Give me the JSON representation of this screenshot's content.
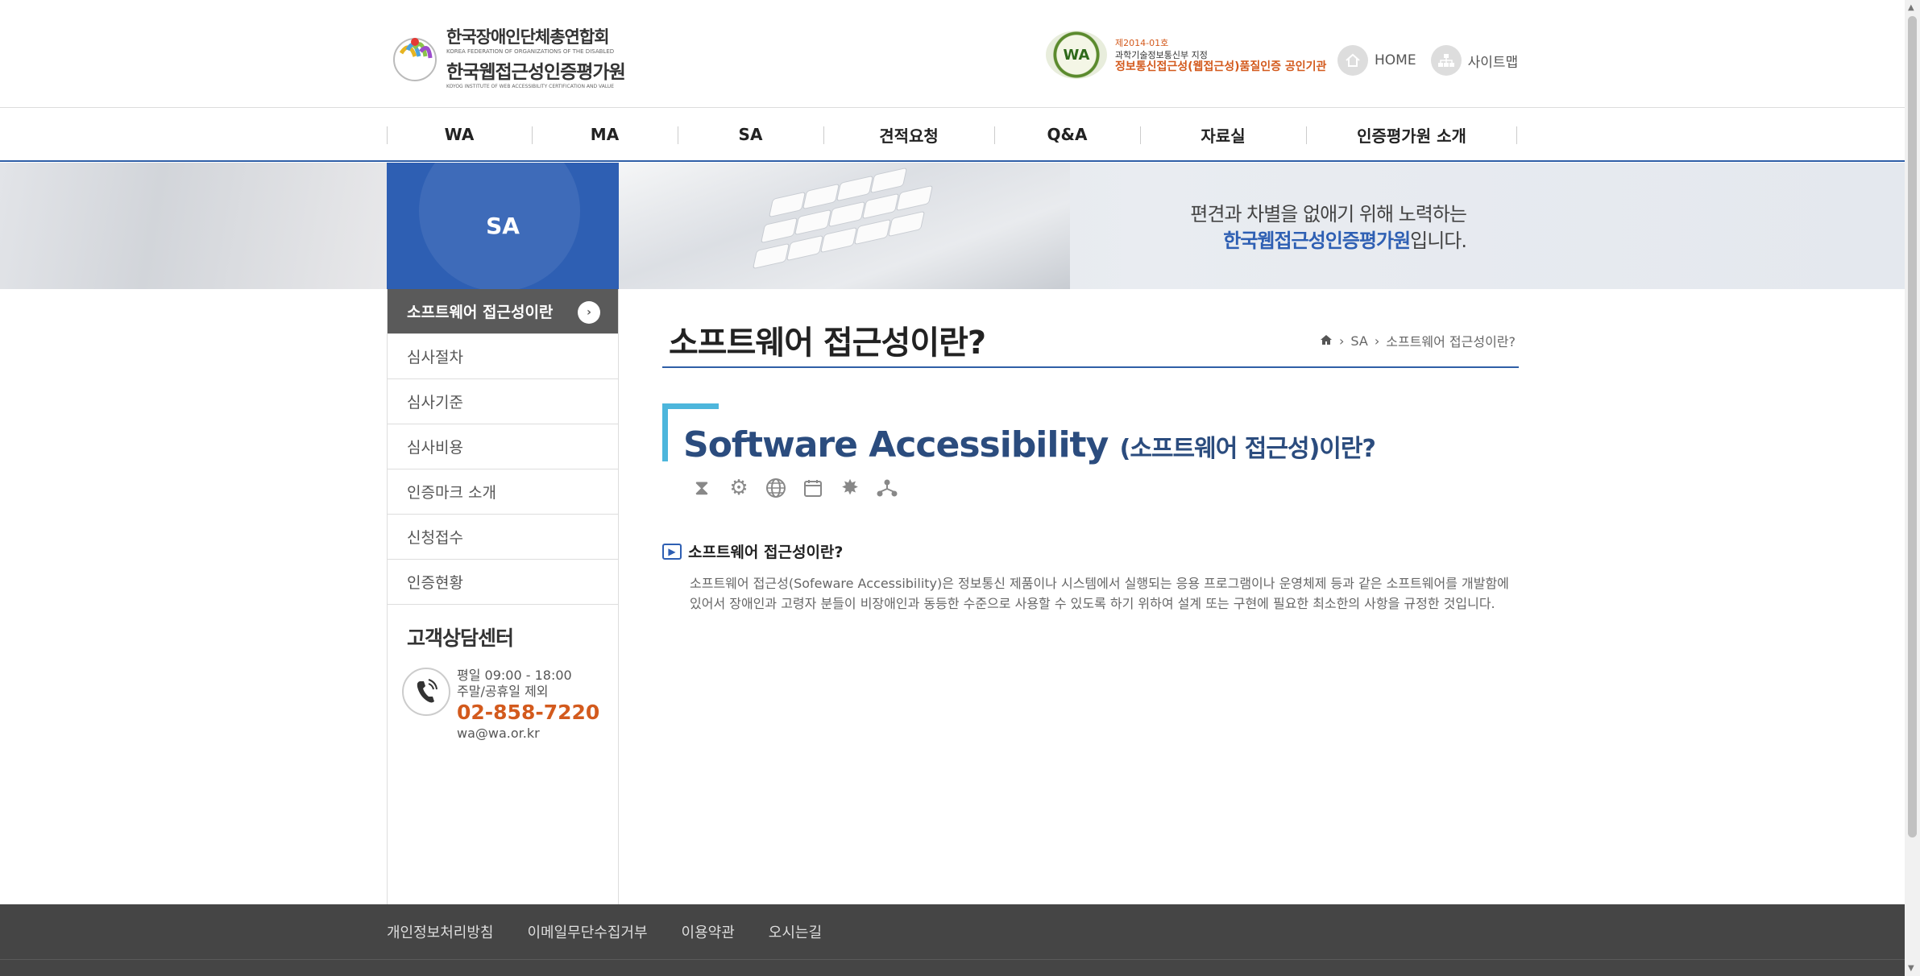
{
  "header": {
    "logo": {
      "line1": "한국장애인단체총연합회",
      "line1_en": "KOREA FEDERATION OF ORGANIZATIONS OF THE DISABLED",
      "line2": "한국웹접근성인증평가원",
      "line2_en": "KOYOG INSTITUTE OF WEB ACCESSIBILITY CERTIFICATION AND VALUE"
    },
    "cert": {
      "badge": "WA",
      "no": "제2014-01호",
      "line2": "과학기술정보통신부 지정",
      "line3": "정보통신접근성(웹접근성)품질인증 공인기관"
    },
    "links": {
      "home": "HOME",
      "sitemap": "사이트맵"
    }
  },
  "nav": {
    "items": [
      "WA",
      "MA",
      "SA",
      "견적요청",
      "Q&A",
      "자료실",
      "인증평가원 소개"
    ]
  },
  "banner": {
    "section": "SA",
    "line1": "편견과 차별을 없애기 위해 노력하는",
    "line2_highlight": "한국웹접근성인증평가원",
    "line2_rest": "입니다."
  },
  "sidebar": {
    "items": [
      "소프트웨어 접근성이란",
      "심사절차",
      "심사기준",
      "심사비용",
      "인증마크 소개",
      "신청접수",
      "인증현황"
    ],
    "active_arrow": "›",
    "cs_title": "고객상담센터",
    "cs_hours1": "평일 09:00 - 18:00",
    "cs_hours2": "주말/공휴일 제외",
    "cs_phone": "02-858-7220",
    "cs_email": "wa@wa.or.kr"
  },
  "content": {
    "title": "소프트웨어 접근성이란?",
    "breadcrumb": [
      "SA",
      "소프트웨어 접근성이란?"
    ],
    "sa_title": "Software Accessibility",
    "sa_sub": "(소프트웨어 접근성)이란?",
    "section_title": "소프트웨어 접근성이란?",
    "section_line1": "소프트웨어 접근성(Sofeware Accessibility)은 정보통신 제품이나 시스템에서 실행되는 응용 프로그램이나 운영체제 등과 같은 소프트웨어를 개발함에",
    "section_line2": "있어서 장애인과 고령자 분들이 비장애인과 동등한 수준으로 사용할 수 있도록 하기 위하여 설계 또는 구현에 필요한 최소한의 사항을 규정한 것입니다."
  },
  "footer": {
    "links": [
      "개인정보처리방침",
      "이메일무단수집거부",
      "이용약관",
      "오시는길"
    ]
  }
}
